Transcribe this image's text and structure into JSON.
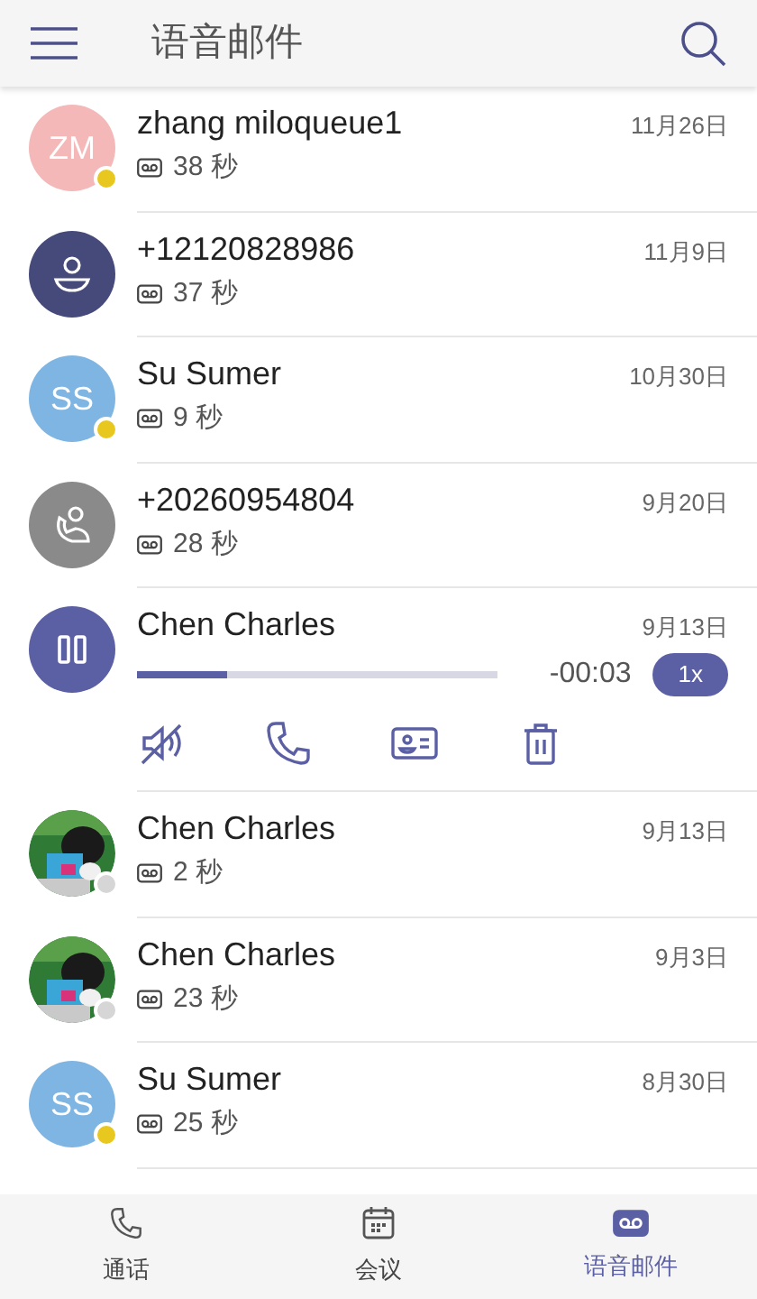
{
  "header": {
    "title": "语音邮件"
  },
  "voicemails": [
    {
      "name": "zhang miloqueue1",
      "date": "11月26日",
      "duration": "38 秒",
      "avatar": {
        "kind": "initials",
        "text": "ZM",
        "color": "#f4b8b8"
      },
      "presence": {
        "color": "#e8c81e"
      }
    },
    {
      "name": "+12120828986",
      "date": "11月9日",
      "duration": "37 秒",
      "avatar": {
        "kind": "person"
      }
    },
    {
      "name": "Su Sumer",
      "date": "10月30日",
      "duration": "9 秒",
      "avatar": {
        "kind": "initials",
        "text": "SS",
        "color": "#7fb5e2"
      },
      "presence": {
        "color": "#e8c81e"
      }
    },
    {
      "name": "+20260954804",
      "date": "9月20日",
      "duration": "28 秒",
      "avatar": {
        "kind": "phone"
      }
    },
    {
      "name": "Chen Charles",
      "date": "9月13日",
      "avatar": {
        "kind": "playing"
      },
      "player": {
        "level": 0.25,
        "remaining": "-00:03",
        "speed": "1x"
      }
    },
    {
      "name": "Chen Charles",
      "date": "9月13日",
      "duration": "2 秒",
      "presence": {
        "color": "#d6d6d6"
      }
    },
    {
      "name": "Chen Charles",
      "date": "9月3日",
      "duration": "23 秒",
      "presence": {
        "color": "#d6d6d6"
      }
    },
    {
      "name": "Su Sumer",
      "date": "8月30日",
      "duration": "25 秒",
      "avatar": {
        "kind": "initials",
        "text": "SS",
        "color": "#7fb5e2"
      },
      "presence": {
        "color": "#e8c81e"
      }
    }
  ],
  "tabs": [
    {
      "label": "通话",
      "kind": "phone",
      "selected": false
    },
    {
      "label": "会议",
      "kind": "calendar",
      "selected": false
    },
    {
      "label": "语音邮件",
      "kind": "voicemail",
      "selected": true
    }
  ]
}
